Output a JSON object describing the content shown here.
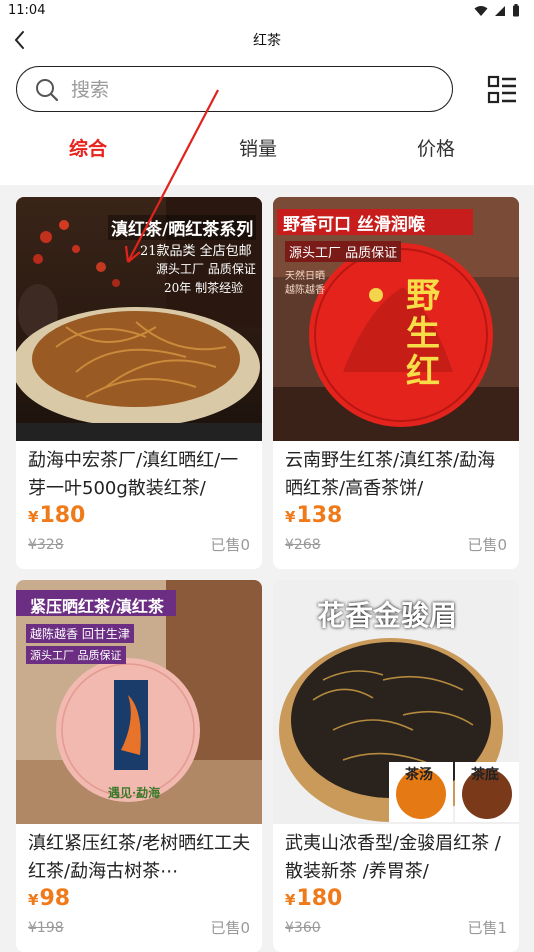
{
  "status": {
    "time": "11:04"
  },
  "header": {
    "title": "红茶"
  },
  "search": {
    "placeholder": "搜索",
    "value": ""
  },
  "tabs": [
    {
      "label": "综合",
      "active": true
    },
    {
      "label": "销量",
      "active": false
    },
    {
      "label": "价格",
      "active": false
    }
  ],
  "products": [
    {
      "name": "勐海中宏茶厂/滇红晒红/一芽一叶500g散装红茶/",
      "price": "180",
      "currency": "¥",
      "original": "¥328",
      "sold": "已售0",
      "banner": [
        "滇红茶/晒红茶系列",
        "21款品类 全店包邮",
        "源头工厂 品质保证",
        "20年 制茶经验"
      ]
    },
    {
      "name": "云南野生红茶/滇红茶/勐海晒红茶/高香茶饼/",
      "price": "138",
      "currency": "¥",
      "original": "¥268",
      "sold": "已售0",
      "banner": [
        "野香可口 丝滑润喉",
        "源头工厂 品质保证",
        "天然日晒",
        "越陈越香",
        "野生红"
      ]
    },
    {
      "name": "滇红紧压红茶/老树晒红工夫红茶/勐海古树茶⋯",
      "price": "98",
      "currency": "¥",
      "original": "¥198",
      "sold": "已售0",
      "banner": [
        "紧压晒红茶/滇红茶",
        "越陈越香 回甘生津",
        "源头工厂 品质保证",
        "遇见·勐海"
      ]
    },
    {
      "name": "武夷山浓香型/金骏眉红茶 /散装新茶 /养胃茶/",
      "price": "180",
      "currency": "¥",
      "original": "¥360",
      "sold": "已售1",
      "banner": [
        "花香金骏眉",
        "茶汤",
        "茶底"
      ]
    }
  ],
  "colors": {
    "accent": "#e8221b",
    "price": "#ef7a1a",
    "muted": "#9a9a9a"
  }
}
